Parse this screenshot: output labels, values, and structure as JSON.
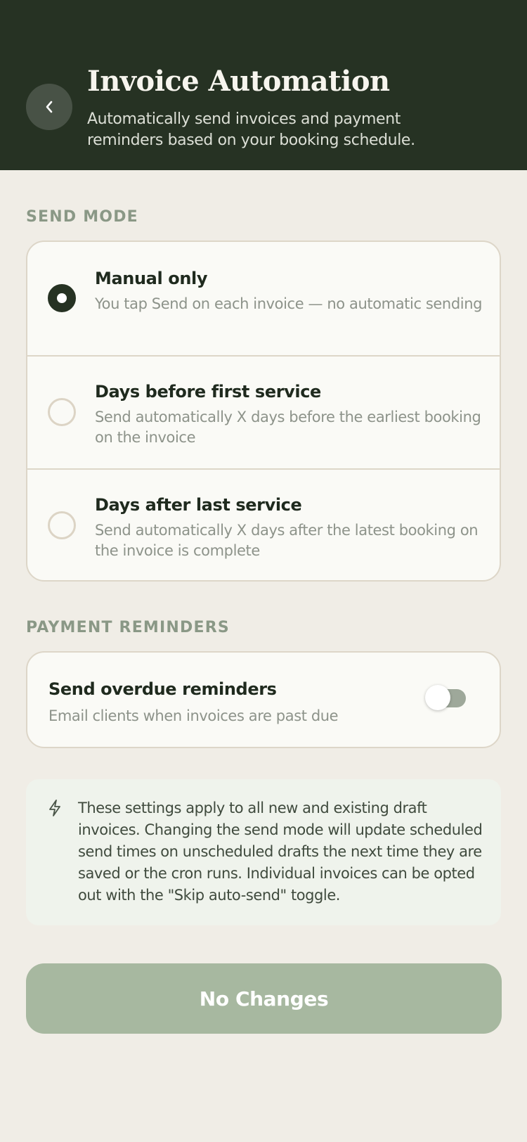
{
  "header": {
    "back_icon": "chevron-left-icon",
    "title": "Invoice Automation",
    "subtitle": "Automatically send invoices and payment reminders based on your booking schedule."
  },
  "send_mode": {
    "label": "SEND MODE",
    "options": [
      {
        "title": "Manual only",
        "description": "You tap Send on each invoice — no automatic sending",
        "selected": true
      },
      {
        "title": "Days before first service",
        "description": "Send automatically X days before the earliest booking on the invoice",
        "selected": false
      },
      {
        "title": "Days after last service",
        "description": "Send automatically X days after the latest booking on the invoice is complete",
        "selected": false
      }
    ]
  },
  "payment_reminders": {
    "label": "PAYMENT REMINDERS",
    "title": "Send overdue reminders",
    "description": "Email clients when invoices are past due",
    "enabled": false
  },
  "info": {
    "icon": "lightning-bolt-icon",
    "text": "These settings apply to all new and existing draft invoices. Changing the send mode will update scheduled send times on unscheduled drafts the next time they are saved or the cron runs. Individual invoices can be opted out with the \"Skip auto-send\" toggle."
  },
  "action": {
    "label": "No Changes"
  },
  "colors": {
    "header_bg": "#263223",
    "page_bg": "#f0ede6",
    "card_bg": "#fafaf6",
    "accent": "#263223",
    "button_disabled": "#a7b8a0",
    "info_bg": "#eff3ec"
  }
}
